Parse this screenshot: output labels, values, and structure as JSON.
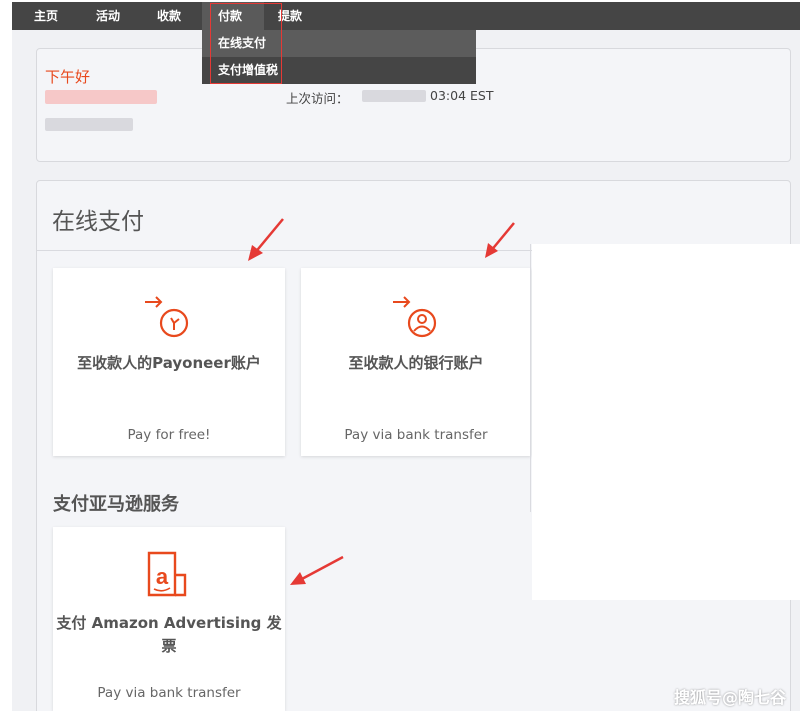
{
  "nav": {
    "items": [
      {
        "label": "主页"
      },
      {
        "label": "活动"
      },
      {
        "label": "收款"
      },
      {
        "label": "付款"
      },
      {
        "label": "提款"
      }
    ],
    "active_index": 3,
    "dropdown": [
      {
        "label": "在线支付"
      },
      {
        "label": "支付增值税"
      }
    ]
  },
  "header": {
    "greeting": "下午好",
    "last_visit_label": "上次访问：",
    "last_visit_time": "03:04 EST"
  },
  "online_payment": {
    "title": "在线支付",
    "cards": [
      {
        "icon": "arrow-clock-icon",
        "title": "至收款人的Payoneer账户",
        "subtitle": "Pay for free!"
      },
      {
        "icon": "arrow-person-icon",
        "title": "至收款人的银行账户",
        "subtitle": "Pay via bank transfer"
      }
    ]
  },
  "amazon_services": {
    "title": "支付亚马逊服务",
    "cards": [
      {
        "icon": "amazon-invoice-icon",
        "title_line1": "支付 Amazon Advertising 发",
        "title_line2": "票",
        "subtitle": "Pay via bank transfer"
      }
    ]
  },
  "colors": {
    "accent": "#e8491d",
    "annotation_red": "#e53935",
    "nav_bg": "#454545"
  },
  "watermark": "搜狐号@陶七谷"
}
